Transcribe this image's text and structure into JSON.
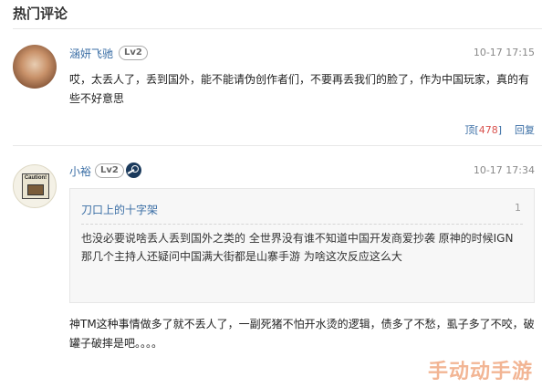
{
  "section": {
    "title": "热门评论"
  },
  "comments": [
    {
      "username": "涵妍飞驰",
      "level": "Lv2",
      "time": "10-17 17:15",
      "text": "哎，太丢人了，丢到国外，能不能请伪创作者们，不要再丢我们的脸了，作为中国玩家，真的有些不好意思",
      "actions": {
        "up_label": "顶",
        "up_count_open": "[",
        "up_count": "478",
        "up_count_close": "]",
        "reply_label": "回复"
      }
    },
    {
      "username": "小裕",
      "level": "Lv2",
      "avatar_caption": "Caution!",
      "time": "10-17 17:34",
      "quote": {
        "author": "刀口上的十字架",
        "floor": "1",
        "text": "也没必要说啥丢人丢到国外之类的 全世界没有谁不知道中国开发商爱抄袭 原神的时候IGN那几个主持人还疑问中国满大街都是山寨手游 为啥这次反应这么大"
      },
      "text": "神TM这种事情做多了就不丢人了，一副死猪不怕开水烫的逻辑，债多了不愁，虱子多了不咬，破罐子破摔是吧。。。。"
    }
  ],
  "watermark": "手动动手游",
  "icons": {
    "steam": "steam-icon",
    "avatar1": "avatar-photo",
    "avatar2": "caution-sign-avatar"
  }
}
